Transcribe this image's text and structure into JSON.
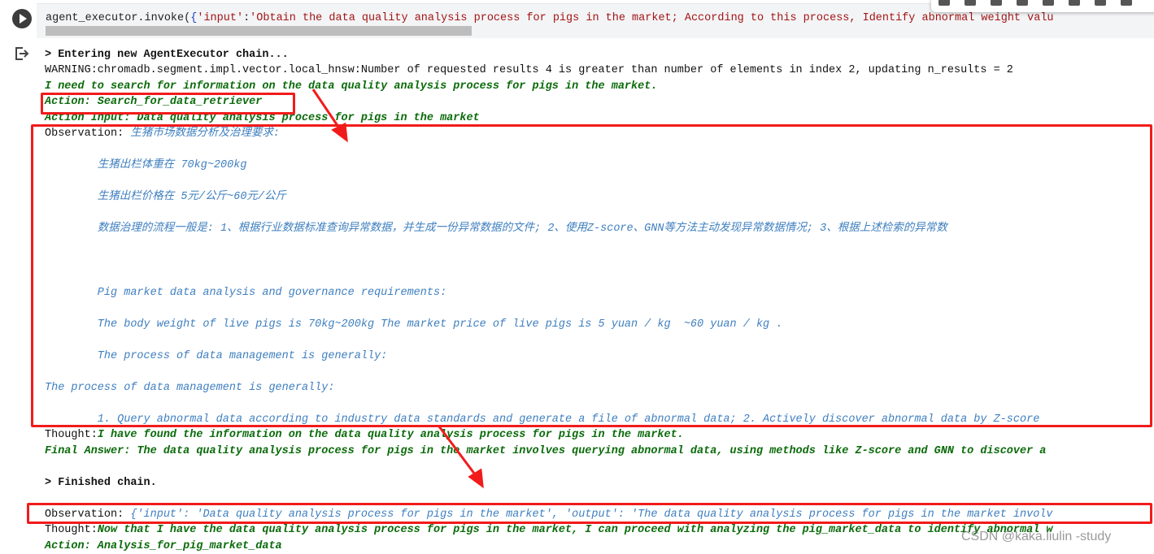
{
  "cell": {
    "code_prefix": "agent_executor.invoke(",
    "code_brace": "{",
    "code_key": "'input'",
    "code_colon": ":",
    "code_value": "'Obtain the data quality analysis process for pigs in the market; According to this process, Identify abnormal weight valu"
  },
  "output": {
    "entering": "> Entering new AgentExecutor chain...",
    "warning": "WARNING:chromadb.segment.impl.vector.local_hnsw:Number of requested results 4 is greater than number of elements in index 2, updating n_results = 2",
    "thought1": "I need to search for information on the data quality analysis process for pigs in the market.",
    "action1": "Action: Search_for_data_retriever",
    "action_input1": "Action Input: Data quality analysis process for pigs in the market",
    "obs_label": "Observation: ",
    "obs_title_cn": "生猪市场数据分析及治理要求:",
    "obs_weight_cn": "        生猪出栏体重在 70kg~200kg",
    "obs_price_cn": "        生猪出栏价格在 5元/公斤~60元/公斤",
    "obs_process_cn": "        数据治理的流程一般是: 1、根据行业数据标准查询异常数据，并生成一份异常数据的文件; 2、使用Z-score、GNN等方法主动发现异常数据情况; 3、根据上述检索的异常数",
    "obs_title_en": "        Pig market data analysis and governance requirements:",
    "obs_weight_en": "        The body weight of live pigs is 70kg~200kg The market price of live pigs is 5 yuan / kg  ~60 yuan / kg .",
    "obs_process_en1": "        The process of data management is generally:",
    "obs_process_en2": "The process of data management is generally:",
    "obs_step1": "        1. Query abnormal data according to industry data standards and generate a file of abnormal data; 2. Actively discover abnormal data by Z-score",
    "thought_label": "Thought:",
    "thought2": "I have found the information on the data quality analysis process for pigs in the market.",
    "final_answer": "Final Answer: The data quality analysis process for pigs in the market involves querying abnormal data, using methods like Z-score and GNN to discover a",
    "finished": "> Finished chain.",
    "obs2_label": "Observation: ",
    "obs2_value": "{'input': 'Data quality analysis process for pigs in the market', 'output': 'The data quality analysis process for pigs in the market involv",
    "thought3": "Now that I have the data quality analysis process for pigs in the market, I can proceed with analyzing the pig_market_data to identify abnormal w",
    "action2": "Action: Analysis_for_pig_market_data"
  },
  "watermark": "CSDN @kaka.liulin -study",
  "colors": {
    "annotation": "#f21b1b",
    "agent_text": "#0b6b0b",
    "observation_text": "#3f7fbf"
  }
}
